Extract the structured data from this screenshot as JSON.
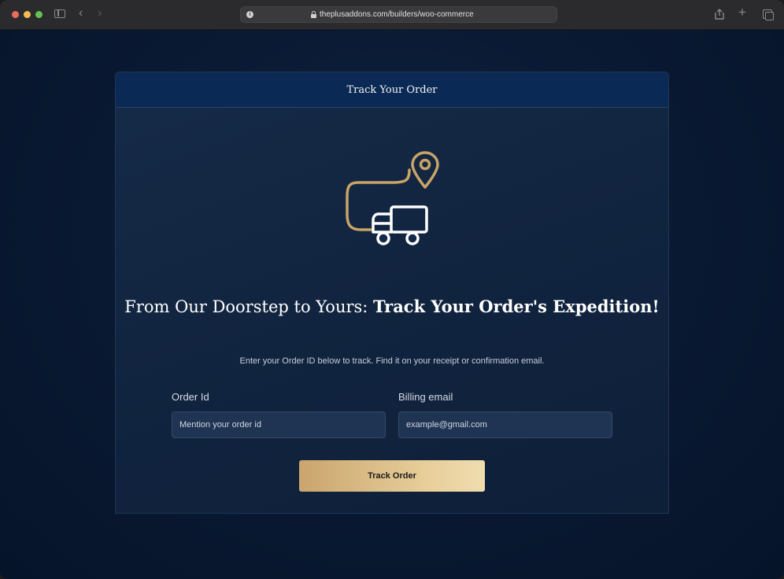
{
  "browser": {
    "url": "theplusaddons.com/builders/woo-commerce",
    "icons": [
      "sidebar-icon",
      "back-icon",
      "forward-icon",
      "info-icon",
      "lock-icon",
      "share-icon",
      "new-tab-icon",
      "tabs-overview-icon"
    ]
  },
  "card": {
    "header_title": "Track Your Order",
    "headline_light": "From Our Doorstep to Yours: ",
    "headline_bold": "Track Your Order's Expedition!",
    "subtitle": "Enter your Order ID below to track. Find it on your receipt or confirmation email.",
    "fields": {
      "order_label": "Order Id",
      "order_placeholder": "Mention your order id",
      "email_label": "Billing email",
      "email_placeholder": "example@gmail.com"
    },
    "button_label": "Track Order",
    "illustration_icons": [
      "location-pin-icon",
      "route-path-icon",
      "delivery-truck-icon"
    ]
  },
  "colors": {
    "accent_gold": "#caa56d",
    "header_blue": "#0a2a55",
    "background": "#0a1a33"
  }
}
